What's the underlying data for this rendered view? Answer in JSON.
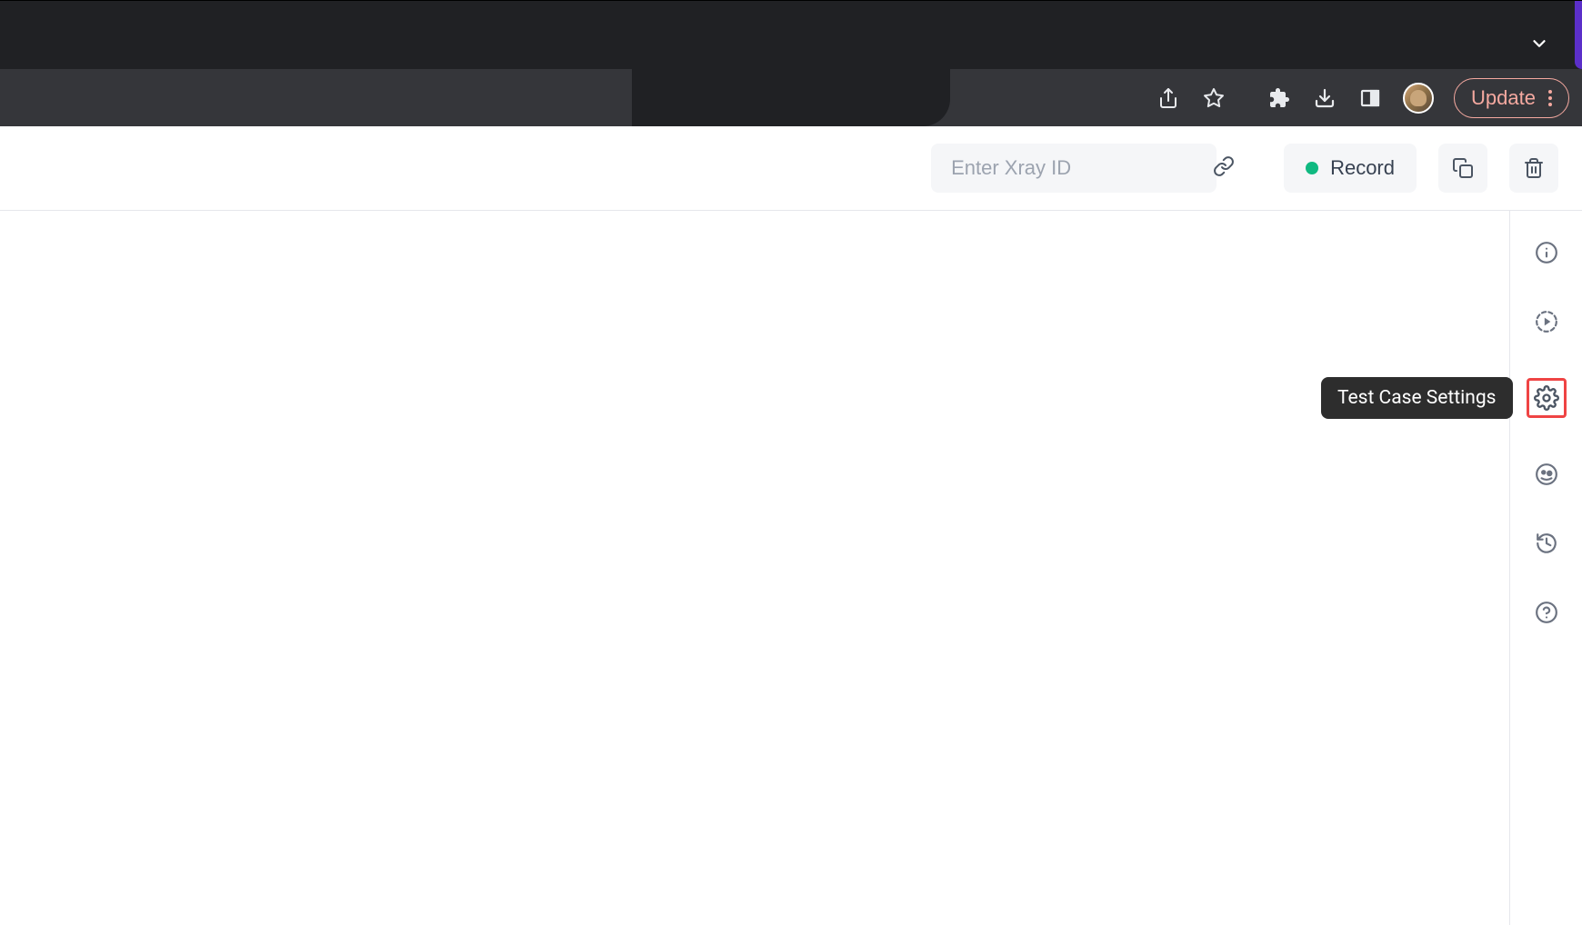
{
  "browser": {
    "updateLabel": "Update"
  },
  "appToolbar": {
    "xrayPlaceholder": "Enter Xray ID",
    "recordLabel": "Record"
  },
  "tooltip": {
    "settingsLabel": "Test Case Settings"
  }
}
